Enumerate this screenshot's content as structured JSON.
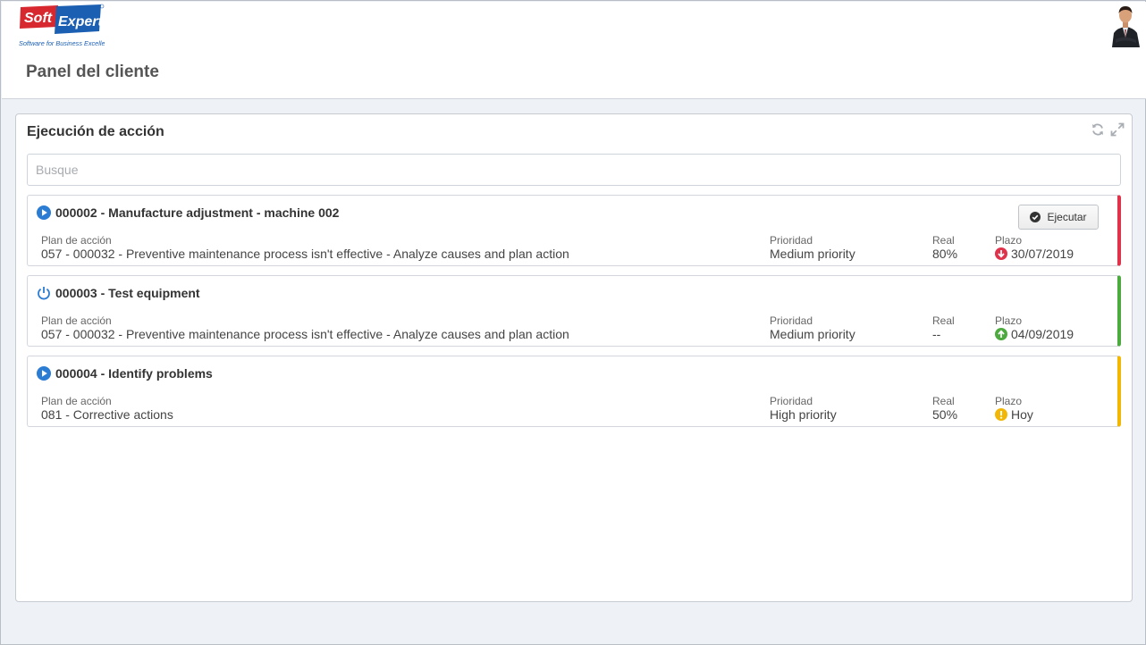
{
  "header": {
    "logo_text_soft": "Soft",
    "logo_text_expert": "Expert",
    "logo_tagline": "Software for Business Excellence",
    "page_title": "Panel del cliente"
  },
  "widget": {
    "title": "Ejecución de acción",
    "search_placeholder": "Busque",
    "search_value": "",
    "tools": [
      "refresh-icon",
      "expand-icon"
    ]
  },
  "labels": {
    "plan": "Plan de acción",
    "priority": "Prioridad",
    "real": "Real",
    "deadline": "Plazo"
  },
  "actions": [
    {
      "title": "000002 - Manufacture adjustment - machine 002",
      "status_icon": "play-icon",
      "plan": "057 - 000032 - Preventive maintenance process isn't effective - Analyze causes and plan action",
      "priority": "Medium priority",
      "real": "80%",
      "deadline": "30/07/2019",
      "deadline_icon": "arrow-down-icon",
      "status_color": "#e0324b",
      "button_label": "Ejecutar"
    },
    {
      "title": "000003 - Test equipment",
      "status_icon": "power-icon",
      "plan": "057 - 000032 - Preventive maintenance process isn't effective - Analyze causes and plan action",
      "priority": "Medium priority",
      "real": "--",
      "deadline": "04/09/2019",
      "deadline_icon": "arrow-up-icon",
      "status_color": "#4daa3f"
    },
    {
      "title": "000004 - Identify problems",
      "status_icon": "play-icon",
      "plan": "081 - Corrective actions",
      "priority": "High priority",
      "real": "50%",
      "deadline": "Hoy",
      "deadline_icon": "warning-icon",
      "status_color": "#f2b705"
    }
  ],
  "colors": {
    "accent_blue": "#2b7cd3",
    "late_red": "#e0324b",
    "ontime_green": "#4daa3f",
    "warning_yellow": "#f2b705"
  }
}
